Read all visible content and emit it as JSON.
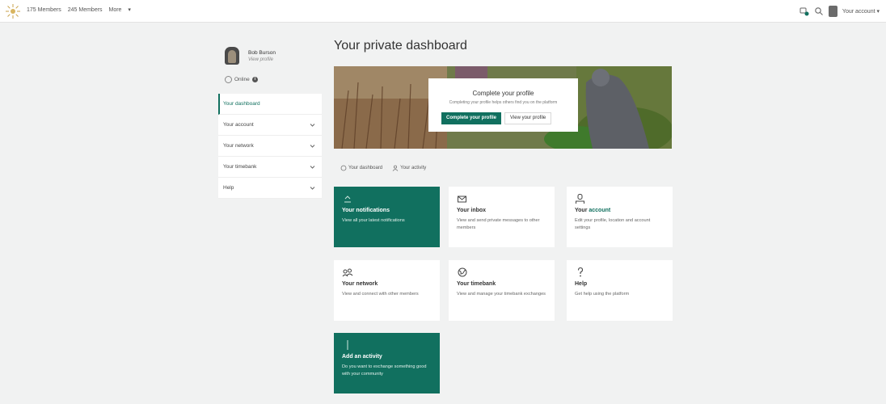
{
  "topbar": {
    "stats": [
      "175 Members",
      "245 Members",
      "More"
    ],
    "account_label": "Your account"
  },
  "sidebar": {
    "profile_name": "Bob Burson",
    "profile_sub": "View profile",
    "status": "Online",
    "nav": [
      {
        "label": "Your dashboard",
        "active": true
      },
      {
        "label": "Your account"
      },
      {
        "label": "Your network"
      },
      {
        "label": "Your timebank"
      },
      {
        "label": "Help"
      }
    ]
  },
  "main": {
    "title": "Your private dashboard",
    "hero": {
      "title": "Complete your profile",
      "subtitle": "Completing your profile helps others find you on the platform",
      "primary_button": "Complete your profile",
      "secondary_button": "View your profile"
    },
    "chips": [
      "Your dashboard",
      "Your activity"
    ],
    "tiles": [
      {
        "title": "Your notifications",
        "desc": "View all your latest notifications",
        "icon": "bell-icon",
        "green": true
      },
      {
        "title": "Your inbox",
        "desc": "View and send private messages to other members",
        "icon": "envelope-icon"
      },
      {
        "title_prefix": "Your ",
        "title_accent": "account",
        "desc": "Edit your profile, location and account settings",
        "icon": "user-icon"
      },
      {
        "title": "Your network",
        "desc": "View and connect with other members",
        "icon": "network-icon"
      },
      {
        "title": "Your timebank",
        "desc": "View and manage your timebank exchanges",
        "icon": "globe-icon"
      },
      {
        "title": "Help",
        "desc": "Get help using the platform",
        "icon": "question-icon"
      },
      {
        "title": "Add an activity",
        "desc": "Do you want to exchange something good with your community",
        "icon": "plus-icon",
        "green": true
      }
    ]
  },
  "colors": {
    "brand": "#11705f",
    "page_bg": "#f1f2f2",
    "card_bg": "#ffffff"
  }
}
